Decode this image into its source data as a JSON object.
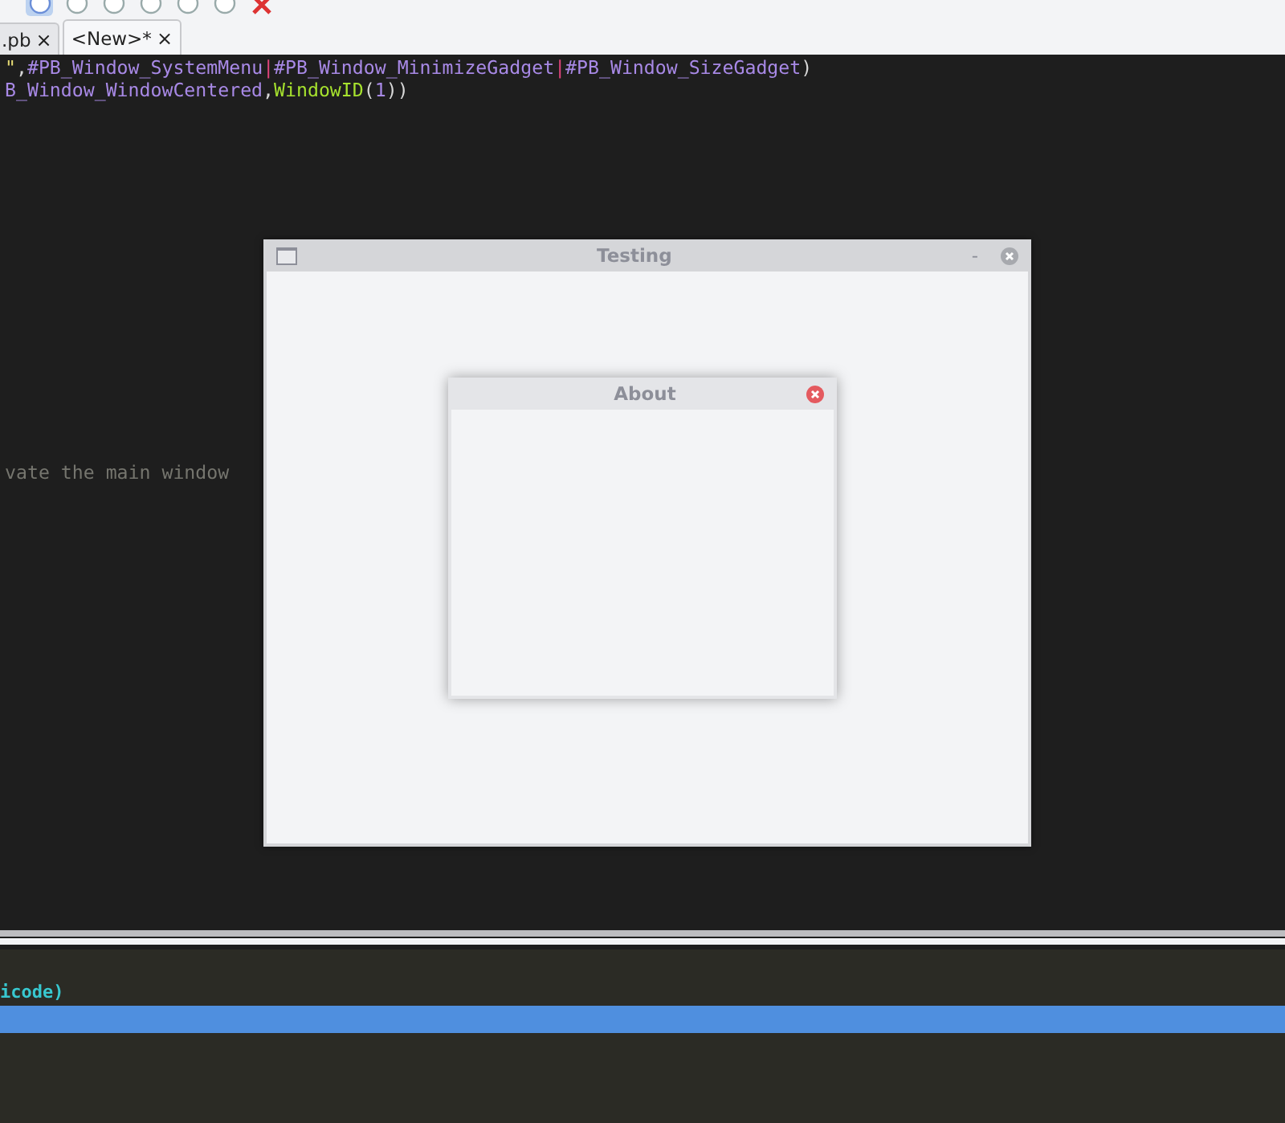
{
  "toolbar": {
    "buttons": [
      {
        "selected": true
      },
      {
        "selected": false
      },
      {
        "selected": false
      },
      {
        "selected": false
      },
      {
        "selected": false
      },
      {
        "selected": false
      },
      {
        "selected": false,
        "kind": "stop"
      }
    ]
  },
  "tabs": [
    {
      "label": ".pb",
      "close": "×",
      "selected": false
    },
    {
      "label": "<New>*",
      "close": "×",
      "selected": true
    }
  ],
  "editor": {
    "lines": [
      [
        {
          "kind": "string",
          "text": "\""
        },
        {
          "kind": "plain",
          "text": ","
        },
        {
          "kind": "constant",
          "text": "#PB_Window_SystemMenu"
        },
        {
          "kind": "operator",
          "text": "|"
        },
        {
          "kind": "constant",
          "text": "#PB_Window_MinimizeGadget"
        },
        {
          "kind": "operator",
          "text": "|"
        },
        {
          "kind": "constant",
          "text": "#PB_Window_SizeGadget"
        },
        {
          "kind": "plain",
          "text": ")"
        }
      ],
      [
        {
          "kind": "constant",
          "text": "B_Window_WindowCentered"
        },
        {
          "kind": "plain",
          "text": ","
        },
        {
          "kind": "function",
          "text": "WindowID"
        },
        {
          "kind": "plain",
          "text": "("
        },
        {
          "kind": "constant",
          "text": "1"
        },
        {
          "kind": "plain",
          "text": "))"
        }
      ],
      [
        {
          "kind": "comment",
          "text": "vate the main window"
        }
      ]
    ]
  },
  "windows": [
    {
      "title": "Testing",
      "minimize": "-",
      "kind": "main"
    },
    {
      "title": "About",
      "kind": "dialog"
    }
  ],
  "output": {
    "lines": [
      {
        "text": "icode)",
        "selected": false
      },
      {
        "selected": true
      }
    ]
  }
}
